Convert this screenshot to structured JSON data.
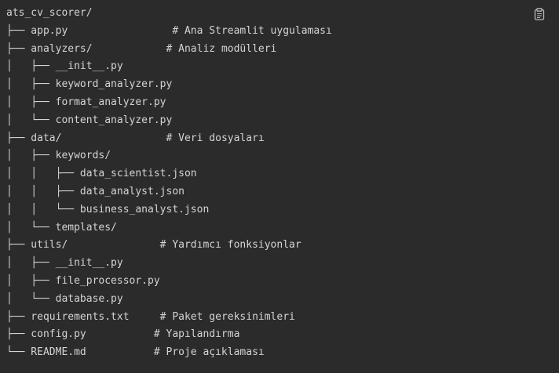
{
  "code_block": {
    "copy_icon": "clipboard-icon",
    "lines": [
      {
        "text": "ats_cv_scorer/",
        "comment": ""
      },
      {
        "text": "├── app.py                 ",
        "comment": "# Ana Streamlit uygulaması"
      },
      {
        "text": "├── analyzers/            ",
        "comment": "# Analiz modülleri"
      },
      {
        "text": "│   ├── __init__.py",
        "comment": ""
      },
      {
        "text": "│   ├── keyword_analyzer.py",
        "comment": ""
      },
      {
        "text": "│   ├── format_analyzer.py",
        "comment": ""
      },
      {
        "text": "│   └── content_analyzer.py",
        "comment": ""
      },
      {
        "text": "├── data/                 ",
        "comment": "# Veri dosyaları"
      },
      {
        "text": "│   ├── keywords/",
        "comment": ""
      },
      {
        "text": "│   │   ├── data_scientist.json",
        "comment": ""
      },
      {
        "text": "│   │   ├── data_analyst.json",
        "comment": ""
      },
      {
        "text": "│   │   └── business_analyst.json",
        "comment": ""
      },
      {
        "text": "│   └── templates/",
        "comment": ""
      },
      {
        "text": "├── utils/               ",
        "comment": "# Yardımcı fonksiyonlar"
      },
      {
        "text": "│   ├── __init__.py",
        "comment": ""
      },
      {
        "text": "│   ├── file_processor.py",
        "comment": ""
      },
      {
        "text": "│   └── database.py",
        "comment": ""
      },
      {
        "text": "├── requirements.txt     ",
        "comment": "# Paket gereksinimleri"
      },
      {
        "text": "├── config.py           ",
        "comment": "# Yapılandırma"
      },
      {
        "text": "└── README.md           ",
        "comment": "# Proje açıklaması"
      }
    ]
  }
}
